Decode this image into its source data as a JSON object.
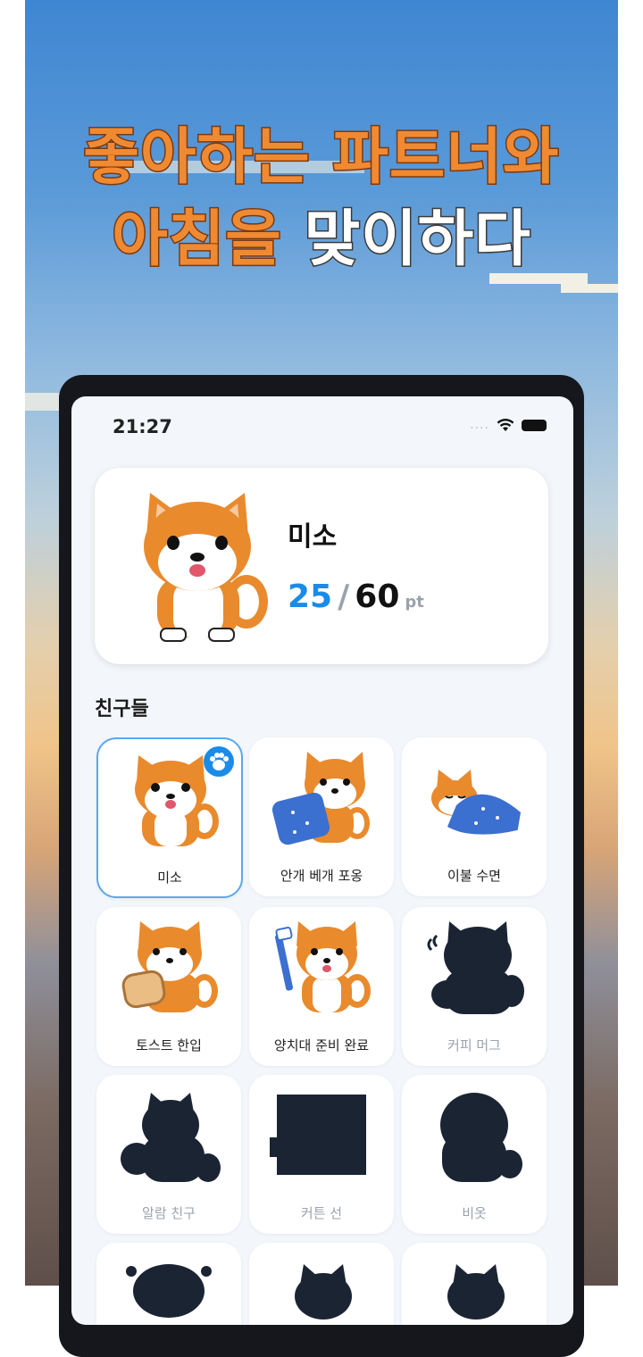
{
  "headline": {
    "line1": "좋아하는 파트너와",
    "line2_orange": "아침을",
    "line2_white": "맞이하다"
  },
  "status_bar": {
    "time": "21:27",
    "signal": "....",
    "icons": [
      "wifi-icon",
      "battery-icon"
    ]
  },
  "hero": {
    "name": "미소",
    "points_current": "25",
    "points_separator": "/",
    "points_total": "60",
    "points_unit": "pt"
  },
  "friends": {
    "title": "친구들",
    "items": [
      {
        "label": "미소",
        "unlocked": true,
        "selected": true
      },
      {
        "label": "안개 베개 포옹",
        "unlocked": true,
        "selected": false
      },
      {
        "label": "이불 수면",
        "unlocked": true,
        "selected": false
      },
      {
        "label": "토스트 한입",
        "unlocked": true,
        "selected": false
      },
      {
        "label": "양치대 준비 완료",
        "unlocked": true,
        "selected": false
      },
      {
        "label": "커피 머그",
        "unlocked": false,
        "selected": false
      },
      {
        "label": "알람 친구",
        "unlocked": false,
        "selected": false
      },
      {
        "label": "커튼 선",
        "unlocked": false,
        "selected": false
      },
      {
        "label": "비옷",
        "unlocked": false,
        "selected": false
      },
      {
        "label": "",
        "unlocked": false,
        "selected": false
      },
      {
        "label": "",
        "unlocked": false,
        "selected": false
      },
      {
        "label": "",
        "unlocked": false,
        "selected": false
      }
    ]
  },
  "colors": {
    "accent": "#1a8be8",
    "headline_orange": "#f08a32",
    "shiba_orange": "#e98a2c"
  }
}
